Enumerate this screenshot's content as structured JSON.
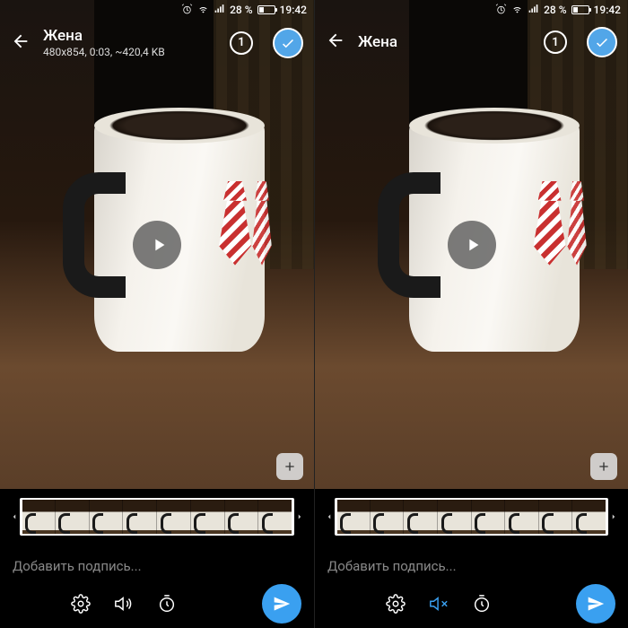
{
  "left": {
    "status": {
      "battery_pct": "28 %",
      "time": "19:42"
    },
    "header": {
      "name": "Жена",
      "info": "480x854, 0:03, ~420,4 KB",
      "count": "1"
    },
    "caption_placeholder": "Добавить подпись...",
    "toolbar": {
      "settings_icon": "gear-icon",
      "sound_icon": "speaker-icon",
      "timer_icon": "timer-icon",
      "sound_muted": false
    },
    "timeline": {
      "frames": 8
    }
  },
  "right": {
    "status": {
      "battery_pct": "28 %",
      "time": "19:42"
    },
    "header": {
      "name": "Жена",
      "info": "",
      "count": "1"
    },
    "caption_placeholder": "Добавить подпись...",
    "toolbar": {
      "settings_icon": "gear-icon",
      "sound_icon": "speaker-muted-icon",
      "timer_icon": "timer-icon",
      "sound_muted": true
    },
    "timeline": {
      "frames": 8
    }
  }
}
